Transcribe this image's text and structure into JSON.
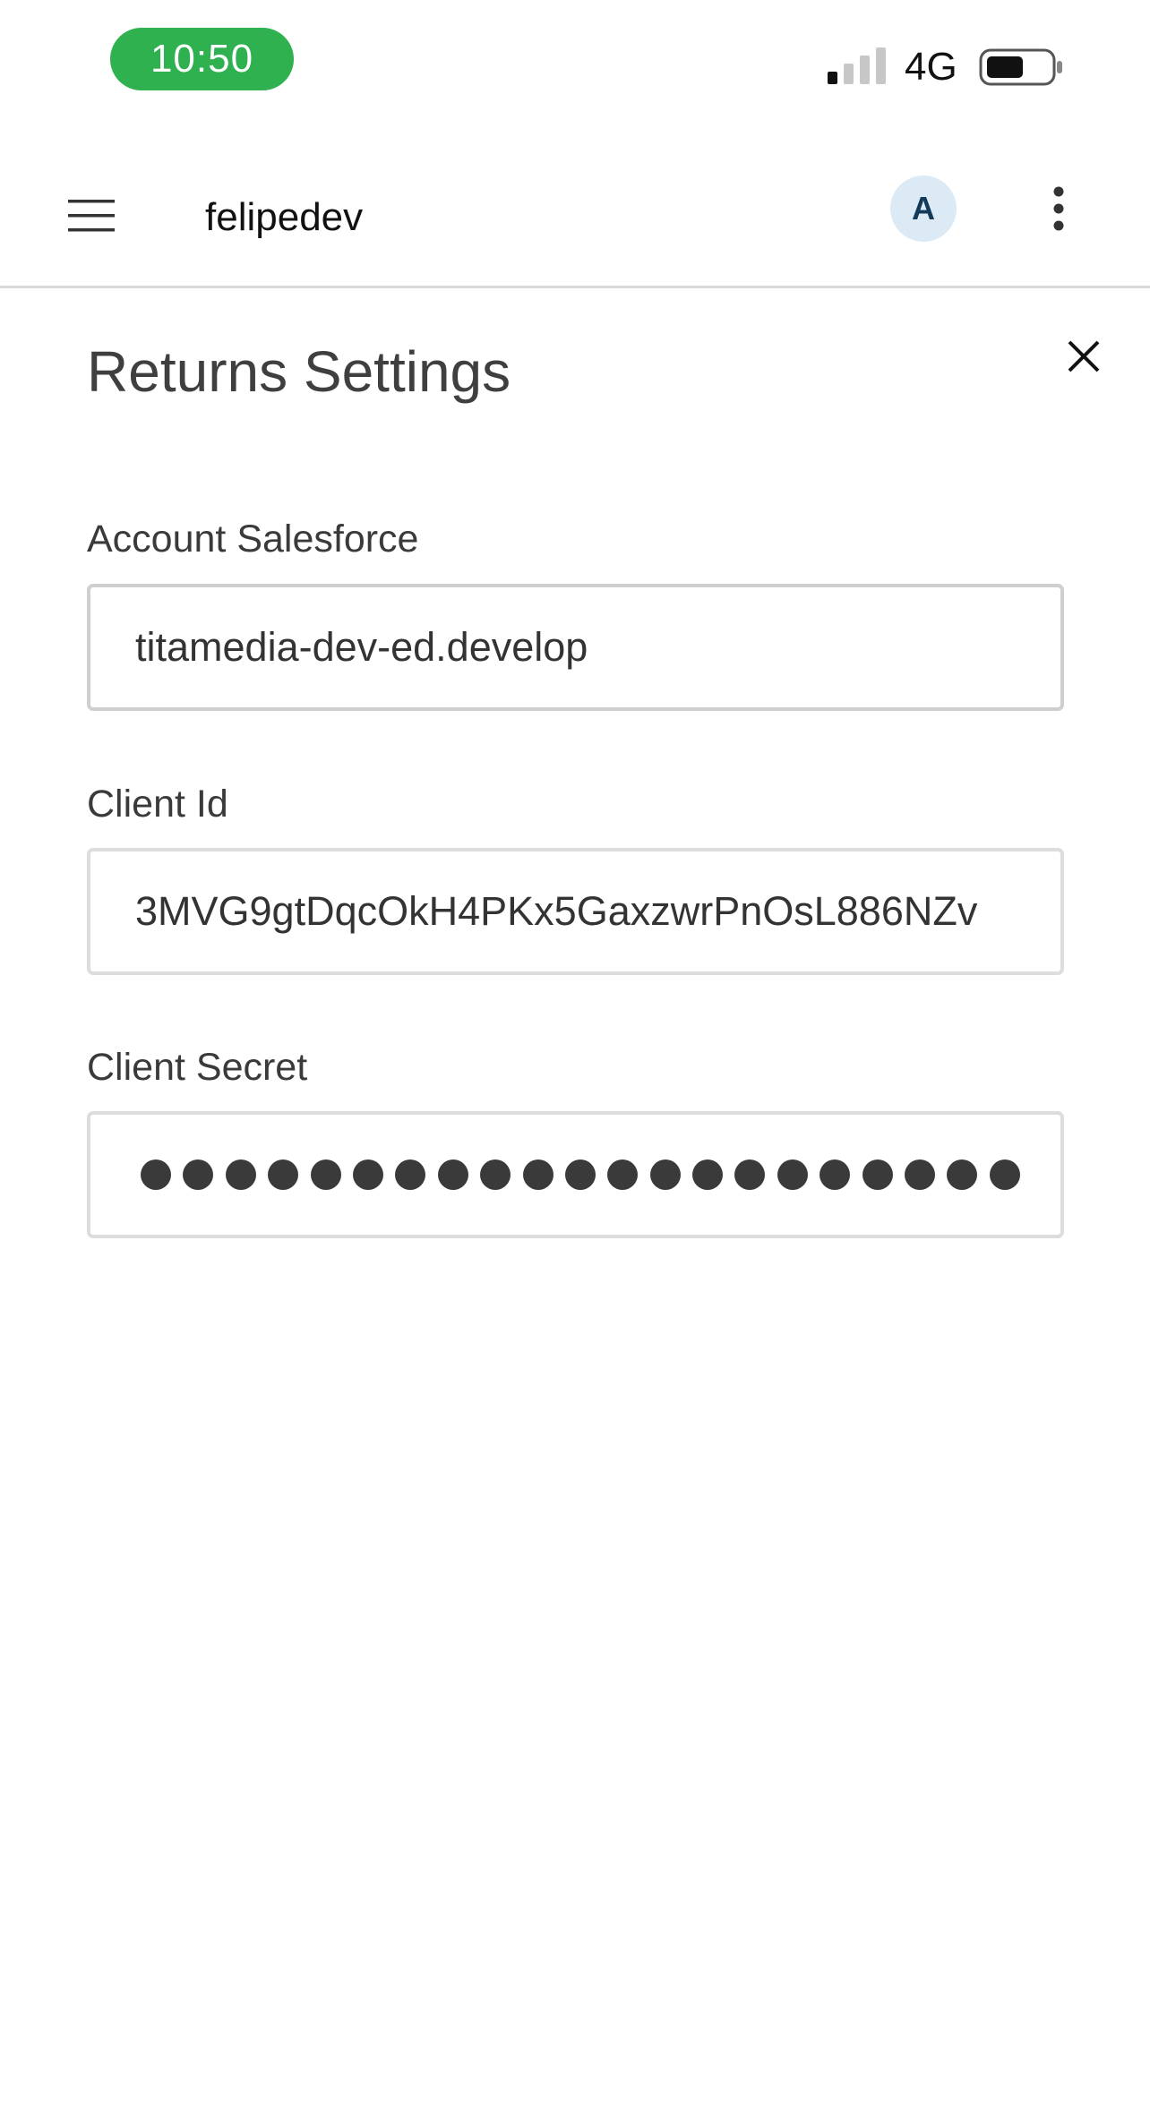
{
  "status_bar": {
    "time": "10:50",
    "network": "4G",
    "icons": [
      "signal-icon",
      "battery-icon"
    ],
    "pill_color": "#2fb14f"
  },
  "app_bar": {
    "store_name": "felipedev",
    "avatar_initial": "A",
    "icons": [
      "hamburger-menu-icon",
      "more-vertical-icon"
    ]
  },
  "panel": {
    "title": "Returns Settings",
    "close_icon": "close-icon",
    "fields": {
      "account": {
        "label": "Account Salesforce",
        "value": "titamedia-dev-ed.develop"
      },
      "client_id": {
        "label": "Client Id",
        "value": "3MVG9gtDqcOkH4PKx5GaxzwrPnOsL886NZv"
      },
      "client_secret": {
        "label": "Client Secret",
        "masked_length": 21
      }
    }
  }
}
